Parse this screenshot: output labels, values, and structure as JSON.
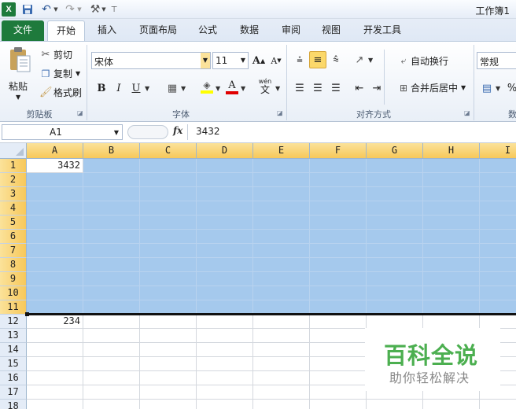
{
  "window": {
    "title": "工作簿1"
  },
  "quick_access": {
    "app_icon": "X",
    "save_icon": "save-icon",
    "undo_icon": "undo-icon",
    "redo_icon": "redo-icon",
    "tools_icon": "tools-icon"
  },
  "tabs": [
    "文件",
    "开始",
    "插入",
    "页面布局",
    "公式",
    "数据",
    "审阅",
    "视图",
    "开发工具"
  ],
  "active_tab": "开始",
  "clipboard": {
    "paste": "粘贴",
    "cut": "剪切",
    "copy": "复制",
    "format_painter": "格式刷",
    "label": "剪贴板"
  },
  "font": {
    "name": "宋体",
    "size": "11",
    "grow": "A",
    "shrink": "A",
    "bold": "B",
    "italic": "I",
    "underline": "U",
    "phonetic": "wén",
    "phonetic_char": "文",
    "label": "字体"
  },
  "alignment": {
    "wrap_text": "自动换行",
    "merge_center": "合并后居中",
    "label": "对齐方式"
  },
  "number": {
    "format": "常规",
    "percent": "%",
    "label_partial": "数"
  },
  "formula_bar": {
    "name_box": "A1",
    "fx": "fx",
    "value": "3432"
  },
  "columns": [
    "A",
    "B",
    "C",
    "D",
    "E",
    "F",
    "G",
    "H",
    "I"
  ],
  "rows": [
    "1",
    "2",
    "3",
    "4",
    "5",
    "6",
    "7",
    "8",
    "9",
    "10",
    "11",
    "12",
    "13",
    "14",
    "15",
    "16",
    "17",
    "18"
  ],
  "cells": {
    "A1": "3432",
    "A12": "234"
  },
  "selection": {
    "range": "A1:I11",
    "active_cell": "A1"
  },
  "watermark": {
    "title": "百科全说",
    "subtitle": "助你轻松解决"
  },
  "colors": {
    "file_tab": "#1e7a3c",
    "selection": "#a5c9ed",
    "header_selected": "#f7c85a",
    "watermark": "#4caf50"
  }
}
